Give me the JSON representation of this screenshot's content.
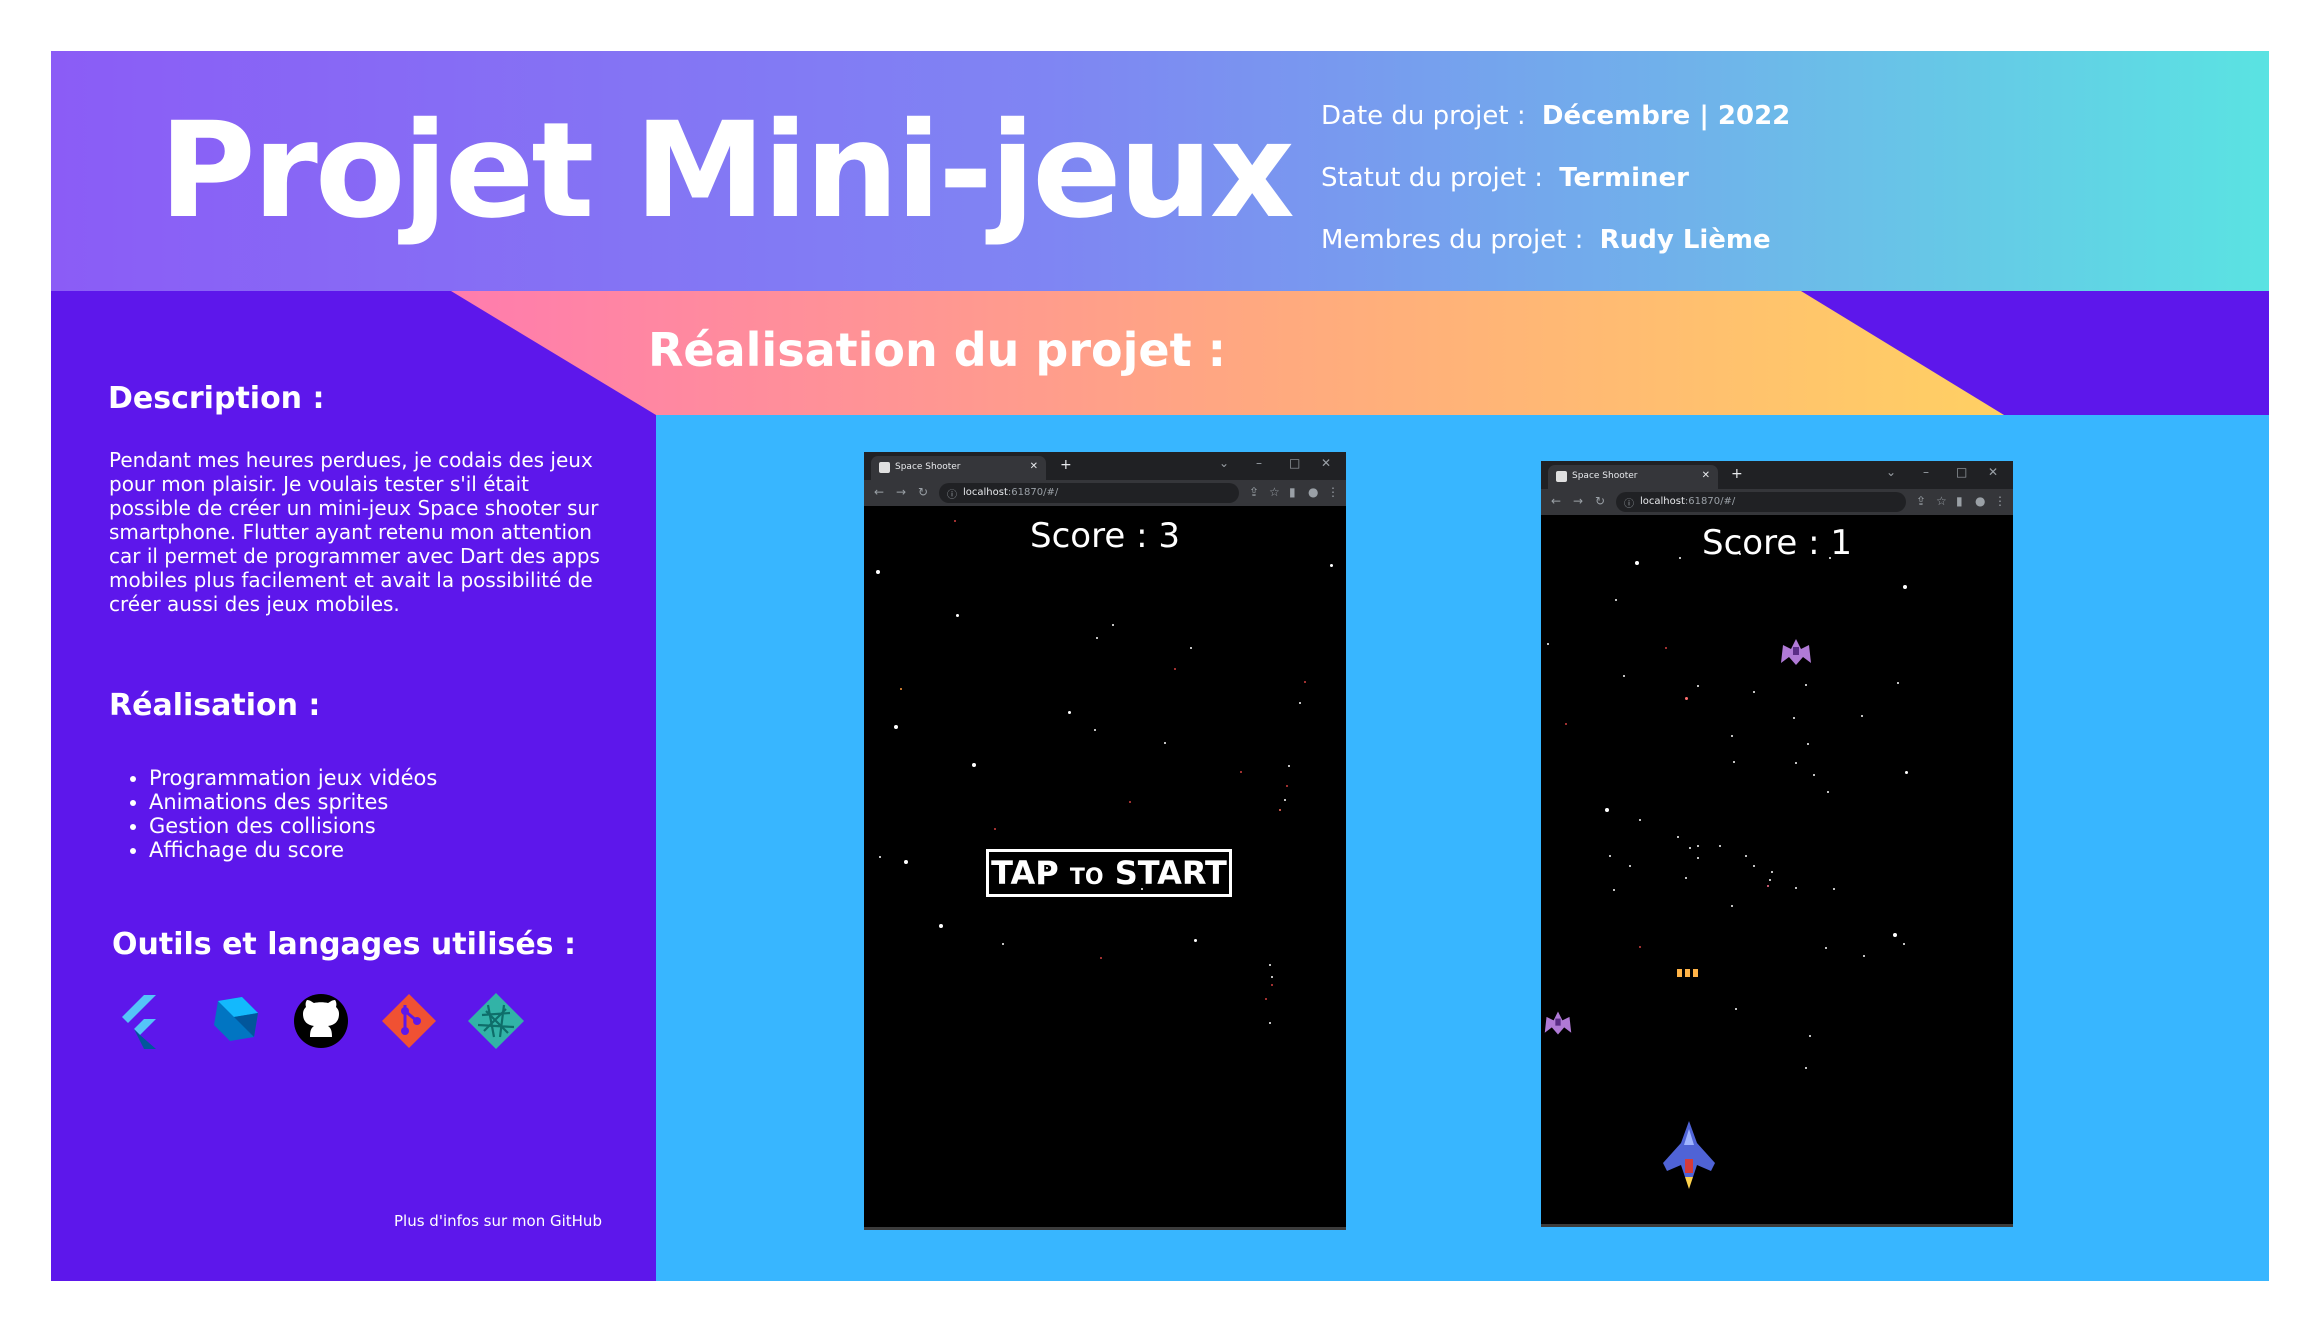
{
  "header": {
    "title": "Projet Mini-jeux",
    "date_label": "Date du projet :",
    "date_value": "Décembre | 2022",
    "status_label": "Statut du projet :",
    "status_value": "Terminer",
    "members_label": "Membres du projet :",
    "members_value": "Rudy Lième"
  },
  "banner": {
    "title": "Réalisation du projet :"
  },
  "sidebar": {
    "description_title": "Description :",
    "description_text": "Pendant mes heures perdues, je codais des jeux pour mon plaisir. Je voulais tester s'il était possible de créer un mini-jeux Space shooter sur smartphone. Flutter ayant retenu mon attention car il permet de programmer avec Dart des apps mobiles plus facilement et avait la possibilité de créer aussi des jeux mobiles.",
    "realisation_title": "Réalisation :",
    "realisation_items": [
      "Programmation jeux vidéos",
      "Animations des sprites",
      "Gestion des collisions",
      "Affichage du score"
    ],
    "tools_title": "Outils et langages utilisés :",
    "tools": [
      "flutter-icon",
      "dart-icon",
      "github-icon",
      "git-icon",
      "netlify-icon"
    ],
    "footer_note": "Plus d'infos sur mon GitHub"
  },
  "screens": [
    {
      "tab_title": "Space Shooter",
      "url_host": "localhost",
      "url_rest": ":61870/#/",
      "score": "Score : 3",
      "overlay_tap": "TAP",
      "overlay_to": "TO",
      "overlay_start": "START"
    },
    {
      "tab_title": "Space Shooter",
      "url_host": "localhost",
      "url_rest": ":61870/#/",
      "score": "Score : 1"
    }
  ],
  "colors": {
    "header_start": "#8b5cf6",
    "header_end": "#5ae3e2",
    "sidebar": "#5d17eb",
    "content_bg": "#38b6ff",
    "banner_start": "#ff66c4",
    "banner_end": "#ffde59"
  }
}
